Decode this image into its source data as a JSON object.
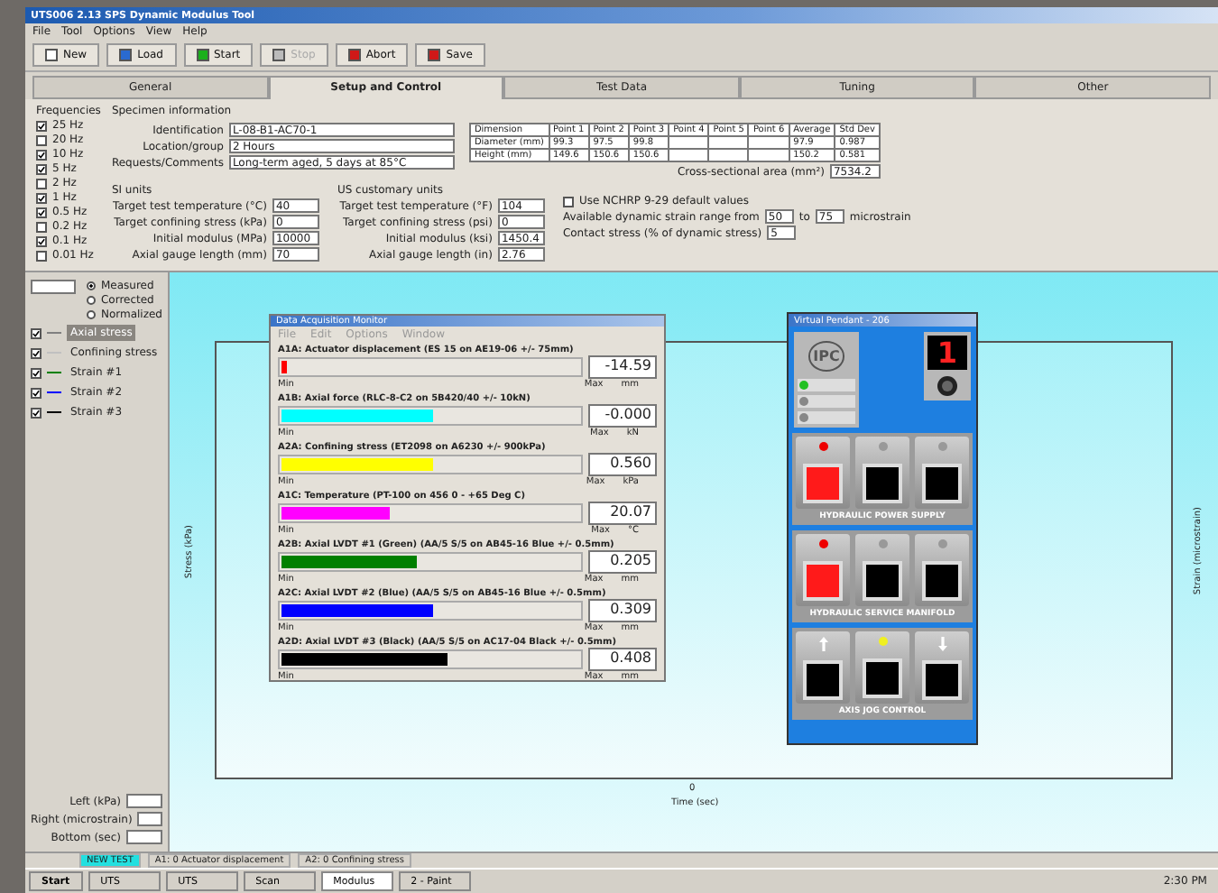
{
  "window": {
    "title": "UTS006 2.13 SPS Dynamic Modulus Tool"
  },
  "menu": [
    "File",
    "Tool",
    "Options",
    "View",
    "Help"
  ],
  "toolbar": [
    {
      "label": "New",
      "kind": "doc",
      "disabled": false
    },
    {
      "label": "Load",
      "kind": "load",
      "disabled": false
    },
    {
      "label": "Start",
      "kind": "go",
      "disabled": false
    },
    {
      "label": "Stop",
      "kind": "stop",
      "disabled": true
    },
    {
      "label": "Abort",
      "kind": "abort",
      "disabled": false
    },
    {
      "label": "Save",
      "kind": "abort",
      "disabled": false
    }
  ],
  "tabs": [
    {
      "label": "General",
      "selected": false
    },
    {
      "label": "Setup and Control",
      "selected": true
    },
    {
      "label": "Test Data",
      "selected": false
    },
    {
      "label": "Tuning",
      "selected": false
    },
    {
      "label": "Other",
      "selected": false
    }
  ],
  "frequencies": {
    "title": "Frequencies",
    "items": [
      {
        "label": "25 Hz",
        "checked": true
      },
      {
        "label": "20 Hz",
        "checked": false
      },
      {
        "label": "10 Hz",
        "checked": true
      },
      {
        "label": "5 Hz",
        "checked": true
      },
      {
        "label": "2 Hz",
        "checked": false
      },
      {
        "label": "1 Hz",
        "checked": true
      },
      {
        "label": "0.5 Hz",
        "checked": true
      },
      {
        "label": "0.2 Hz",
        "checked": false
      },
      {
        "label": "0.1 Hz",
        "checked": true
      },
      {
        "label": "0.01 Hz",
        "checked": false
      }
    ]
  },
  "specimen": {
    "title": "Specimen information",
    "fields": [
      {
        "label": "Identification",
        "value": "L-08-B1-AC70-1"
      },
      {
        "label": "Location/group",
        "value": "2 Hours"
      },
      {
        "label": "Requests/Comments",
        "value": "Long-term aged, 5 days at 85°C"
      }
    ]
  },
  "dimensions": {
    "columns": [
      "Dimension",
      "Point 1",
      "Point 2",
      "Point 3",
      "Point 4",
      "Point 5",
      "Point 6",
      "Average",
      "Std Dev"
    ],
    "rows": [
      [
        "Diameter (mm)",
        "99.3",
        "97.5",
        "99.8",
        "",
        "",
        "",
        "97.9",
        "0.987"
      ],
      [
        "Height (mm)",
        "149.6",
        "150.6",
        "150.6",
        "",
        "",
        "",
        "150.2",
        "0.581"
      ]
    ],
    "area_label": "Cross-sectional area (mm²)",
    "area_value": "7534.2"
  },
  "si_units": {
    "title": "SI units",
    "fields": [
      {
        "label": "Target test temperature (°C)",
        "value": "40"
      },
      {
        "label": "Target confining stress (kPa)",
        "value": "0"
      },
      {
        "label": "Initial modulus (MPa)",
        "value": "10000"
      },
      {
        "label": "Axial gauge length (mm)",
        "value": "70"
      }
    ]
  },
  "us_units": {
    "title": "US customary units",
    "fields": [
      {
        "label": "Target test temperature (°F)",
        "value": "104"
      },
      {
        "label": "Target confining stress (psi)",
        "value": "0"
      },
      {
        "label": "Initial modulus (ksi)",
        "value": "1450.4"
      },
      {
        "label": "Axial gauge length (in)",
        "value": "2.76"
      }
    ]
  },
  "defaults": {
    "label": "Use NCHRP 9-29 default values",
    "checked": false,
    "range_label": "Available dynamic strain range from",
    "range_from": "50",
    "range_to_label": "to",
    "range_to": "75",
    "range_unit": "microstrain",
    "contact_label": "Contact stress (% of dynamic stress)",
    "contact_value": "5"
  },
  "plot_options": {
    "radios": [
      {
        "label": "Measured",
        "selected": true
      },
      {
        "label": "Corrected",
        "selected": false
      },
      {
        "label": "Normalized",
        "selected": false
      }
    ],
    "legend": [
      {
        "label": "Axial stress",
        "checked": true,
        "selected": true,
        "color": "#808080"
      },
      {
        "label": "Confining stress",
        "checked": true,
        "selected": false,
        "color": "#c0c0c0"
      },
      {
        "label": "Strain #1",
        "checked": true,
        "selected": false,
        "color": "#008000"
      },
      {
        "label": "Strain #2",
        "checked": true,
        "selected": false,
        "color": "#0000ff"
      },
      {
        "label": "Strain #3",
        "checked": true,
        "selected": false,
        "color": "#000000"
      }
    ],
    "scales": [
      "Left (kPa)",
      "Right (microstrain)",
      "Bottom (sec)"
    ]
  },
  "plot": {
    "ylabel": "Stress (kPa)",
    "y2label": "Strain (microstrain)",
    "xlabel": "Time (sec)",
    "xtick": "0"
  },
  "monitor": {
    "title": "Data Acquisition Monitor",
    "menu": [
      "File",
      "Edit",
      "Options",
      "Window"
    ],
    "channels": [
      {
        "name": "A1A:  Actuator displacement (ES 15 on AE19-06 +/- 75mm)",
        "level": 0.02,
        "color": "#ff0000",
        "reading": "-14.59",
        "unit": "mm",
        "min": "Min",
        "max": "Max"
      },
      {
        "name": "A1B:  Axial force (RLC-8-C2 on 5B420/40 +/- 10kN)",
        "level": 0.5,
        "color": "#00ffff",
        "reading": "-0.000",
        "unit": "kN",
        "min": "Min",
        "max": "Max"
      },
      {
        "name": "A2A:  Confining stress (ET2098 on A6230 +/- 900kPa)",
        "level": 0.5,
        "color": "#ffff00",
        "reading": "0.560",
        "unit": "kPa",
        "min": "Min",
        "max": "Max"
      },
      {
        "name": "A1C:  Temperature (PT-100 on 456  0 - +65 Deg C)",
        "level": 0.36,
        "color": "#ff00ff",
        "reading": "20.07",
        "unit": "°C",
        "min": "Min",
        "max": "Max"
      },
      {
        "name": "A2B:  Axial LVDT #1 (Green) (AA/5 S/5 on AB45-16 Blue +/- 0.5mm)",
        "level": 0.45,
        "color": "#008000",
        "reading": "0.205",
        "unit": "mm",
        "min": "Min",
        "max": "Max"
      },
      {
        "name": "A2C:  Axial LVDT #2 (Blue) (AA/5 S/5 on AB45-16 Blue +/- 0.5mm)",
        "level": 0.5,
        "color": "#0000ff",
        "reading": "0.309",
        "unit": "mm",
        "min": "Min",
        "max": "Max"
      },
      {
        "name": "A2D:  Axial LVDT #3 (Black) (AA/5 S/5 on AC17-04 Black +/- 0.5mm)",
        "level": 0.55,
        "color": "#000000",
        "reading": "0.408",
        "unit": "mm",
        "min": "Min",
        "max": "Max"
      }
    ]
  },
  "pendant": {
    "title": "Virtual Pendant - 206",
    "logo": "IPC",
    "display": "1",
    "lights": [
      {
        "on": true
      },
      {
        "on": false
      },
      {
        "on": false
      }
    ],
    "groups": [
      {
        "label": "HYDRAULIC POWER SUPPLY",
        "buttons": [
          {
            "kind": "toggle",
            "on": true
          },
          {
            "kind": "toggle",
            "on": false
          },
          {
            "kind": "toggle",
            "on": false
          }
        ]
      },
      {
        "label": "HYDRAULIC SERVICE MANIFOLD",
        "buttons": [
          {
            "kind": "toggle",
            "on": true
          },
          {
            "kind": "toggle",
            "on": false
          },
          {
            "kind": "toggle",
            "on": false
          }
        ]
      },
      {
        "label": "AXIS JOG CONTROL",
        "buttons": [
          {
            "kind": "up"
          },
          {
            "kind": "led",
            "on": true
          },
          {
            "kind": "down"
          }
        ]
      }
    ]
  },
  "status_bar": [
    {
      "text": "NEW TEST",
      "kind": "highlight"
    },
    {
      "text": "A1: 0 Actuator displacement",
      "kind": "plain"
    },
    {
      "text": "A2: 0 Confining stress",
      "kind": "plain"
    }
  ],
  "taskbar": {
    "start": "Start",
    "items": [
      {
        "label": "UTS",
        "selected": false
      },
      {
        "label": "UTS",
        "selected": false
      },
      {
        "label": "Scan",
        "selected": false
      },
      {
        "label": "Modulus",
        "selected": true
      },
      {
        "label": "2 - Paint",
        "selected": false
      }
    ],
    "clock": "2:30 PM"
  }
}
